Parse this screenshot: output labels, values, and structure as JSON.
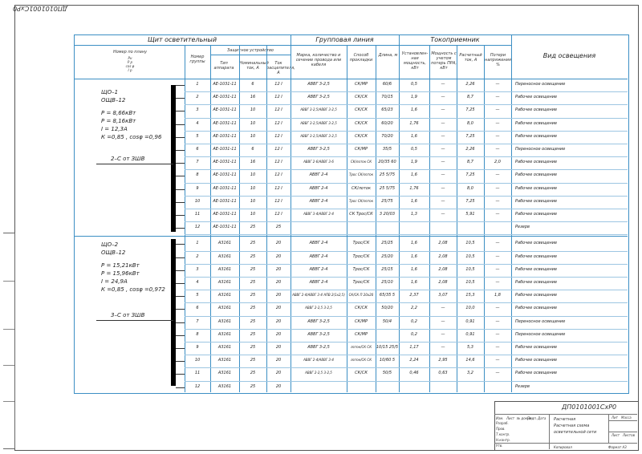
{
  "doc": {
    "stamp_top": "ДП0101001СхР0",
    "code": "ДП0101001СхР0"
  },
  "header": {
    "shield": "Щит осветительный",
    "group_line": "Групповая линия",
    "receiver": "Токоприемник",
    "light_kind": "Вид освещения",
    "plan_no": "Номер по плану",
    "plan_sub": [
      "Рн",
      "Р р",
      "cos φ",
      "I р"
    ],
    "group_no": "Номер группы",
    "protect": "Защитное устройство",
    "device_type": "Тип аппарата",
    "nominal": "Номинальный ток, А",
    "release": "Ток расцепителя, А",
    "cable": "Марка, количество и сечение провода или кабеля",
    "method": "Способ прокладки",
    "length": "Длина, м",
    "installed": "Установлен-ная мощность, кВт",
    "power_corr": "Мощность с учетом потерь ПРА, кВт",
    "calc_current": "Расчетный ток, А",
    "voltage_loss": "Потери напряжения %"
  },
  "panel1": {
    "name1": "ЩО–1",
    "name2": "ОЩВ–12",
    "p_inst": "Р = 8,66кВт",
    "p_calc": "Р = 8,16кВт",
    "i_calc": "I = 12,3А",
    "kc": "К =0,85 , cosφ =0,96",
    "feed": "2–С от ЗШВ"
  },
  "panel2": {
    "name1": "ЩО–2",
    "name2": "ОЩВ–12",
    "p_inst": "Р = 15,21кВт",
    "p_calc": "Р = 15,96кВт",
    "i_calc": "I = 24,9А",
    "kc": "К =0,85 , cosφ =0,972",
    "feed": "3–С от ЗШВ"
  },
  "rows1": [
    {
      "g": "1",
      "type": "АЕ-1031-11",
      "nom": "6",
      "rel": "12 I",
      "cable": "АВВГ 3-2,5",
      "method": "СК/МР",
      "len": "60/6",
      "p": "0,5",
      "pc": "—",
      "i": "2,26",
      "dv": "—",
      "kind": "Переносное освещение"
    },
    {
      "g": "2",
      "type": "АЕ-1031-11",
      "nom": "16",
      "rel": "12 I",
      "cable": "АВВГ 3-2,5",
      "method": "СК/СК",
      "len": "70/15",
      "p": "1,9",
      "pc": "—",
      "i": "8,7",
      "dv": "—",
      "kind": "Рабочее освещение"
    },
    {
      "g": "3",
      "type": "АЕ-1031-11",
      "nom": "10",
      "rel": "12 I",
      "cable": "АВВГ 3-2,5/АВВГ 3-2,5",
      "method": "СК/СК",
      "len": "65/23",
      "p": "1,6",
      "pc": "—",
      "i": "7,25",
      "dv": "—",
      "kind": "Рабочее освещение"
    },
    {
      "g": "4",
      "type": "АЕ-1031-11",
      "nom": "10",
      "rel": "12 I",
      "cable": "АВВГ 3-2,5/АВВГ 3-2,5",
      "method": "СК/СК",
      "len": "60/20",
      "p": "1,76",
      "pc": "—",
      "i": "8,0",
      "dv": "—",
      "kind": "Рабочее освещение"
    },
    {
      "g": "5",
      "type": "АЕ-1031-11",
      "nom": "10",
      "rel": "12 I",
      "cable": "АВВГ 3-2,5/АВВГ 3-2,5",
      "method": "СК/СК",
      "len": "70/20",
      "p": "1,6",
      "pc": "—",
      "i": "7,25",
      "dv": "—",
      "kind": "Рабочее освещение"
    },
    {
      "g": "6",
      "type": "АЕ-1031-11",
      "nom": "6",
      "rel": "12 I",
      "cable": "АВВГ 3-2,5",
      "method": "СК/МР",
      "len": "35/5",
      "p": "0,5",
      "pc": "—",
      "i": "2,26",
      "dv": "—",
      "kind": "Переносное освещение"
    },
    {
      "g": "7",
      "type": "АЕ-1031-11",
      "nom": "16",
      "rel": "12 I",
      "cable": "АВВГ 2-6/АВВГ 3-6",
      "method": "СК/лоток СК",
      "len": "20/35 60",
      "p": "1,9",
      "pc": "—",
      "i": "8,7",
      "dv": "2,0",
      "kind": "Рабочее освещение"
    },
    {
      "g": "8",
      "type": "АЕ-1031-11",
      "nom": "10",
      "rel": "12 I",
      "cable": "АВВГ 2-4",
      "method": "Трос СК/лоток",
      "len": "25 5/75",
      "p": "1,6",
      "pc": "—",
      "i": "7,25",
      "dv": "—",
      "kind": "Рабочее освещение"
    },
    {
      "g": "9",
      "type": "АЕ-1031-11",
      "nom": "10",
      "rel": "12 I",
      "cable": "АВВГ 2-4",
      "method": "СК/лоток",
      "len": "25 5/75",
      "p": "1,76",
      "pc": "—",
      "i": "8,0",
      "dv": "—",
      "kind": "Рабочее освещение"
    },
    {
      "g": "10",
      "type": "АЕ-1031-11",
      "nom": "10",
      "rel": "12 I",
      "cable": "АВВГ 2-4",
      "method": "Трос СК/лоток",
      "len": "25/75",
      "p": "1,6",
      "pc": "—",
      "i": "7,25",
      "dv": "—",
      "kind": "Рабочее освещение"
    },
    {
      "g": "11",
      "type": "АЕ-1031-11",
      "nom": "10",
      "rel": "12 I",
      "cable": "АВВГ 3-4/АВВГ 2-4",
      "method": "СК Трос/СК",
      "len": "3 20/03",
      "p": "1,3",
      "pc": "—",
      "i": "5,91",
      "dv": "—",
      "kind": "Рабочее освещение"
    },
    {
      "g": "12",
      "type": "АЕ-1031-11",
      "nom": "25",
      "rel": "25",
      "cable": "",
      "method": "",
      "len": "",
      "p": "",
      "pc": "",
      "i": "",
      "dv": "",
      "kind": "Резерв"
    }
  ],
  "rows2": [
    {
      "g": "1",
      "type": "А3161",
      "nom": "25",
      "rel": "20",
      "cable": "АВВГ 2-4",
      "method": "Трос/СК",
      "len": "25/25",
      "p": "1,6",
      "pc": "2,08",
      "i": "10,5",
      "dv": "—",
      "kind": "Рабочее освещение"
    },
    {
      "g": "2",
      "type": "А3161",
      "nom": "25",
      "rel": "20",
      "cable": "АВВГ 2-4",
      "method": "Трос/СК",
      "len": "25/20",
      "p": "1,6",
      "pc": "2,08",
      "i": "10,5",
      "dv": "—",
      "kind": "Рабочее освещение"
    },
    {
      "g": "3",
      "type": "А3161",
      "nom": "25",
      "rel": "20",
      "cable": "АВВГ 2-4",
      "method": "Трос/СК",
      "len": "25/15",
      "p": "1,6",
      "pc": "2,08",
      "i": "10,5",
      "dv": "—",
      "kind": "Рабочее освещение"
    },
    {
      "g": "4",
      "type": "А3161",
      "nom": "25",
      "rel": "20",
      "cable": "АВВГ 2-4",
      "method": "Трос/СК",
      "len": "25/10",
      "p": "1,6",
      "pc": "2,08",
      "i": "10,5",
      "dv": "—",
      "kind": "Рабочее освещение"
    },
    {
      "g": "5",
      "type": "А3161",
      "nom": "25",
      "rel": "20",
      "cable": "АВВГ 2-4/АВВГ 3-4 АПВ 2(1х2,5)",
      "method": "СК/СК П 20х20",
      "len": "65/35 5",
      "p": "2,37",
      "pc": "3,07",
      "i": "15,3",
      "dv": "1,8",
      "kind": "Рабочее освещение"
    },
    {
      "g": "6",
      "type": "А3161",
      "nom": "25",
      "rel": "20",
      "cable": "АВВГ 2-2,5 3-2,5",
      "method": "СК/СК",
      "len": "50/20",
      "p": "2,2",
      "pc": "—",
      "i": "10,0",
      "dv": "—",
      "kind": "Рабочее освещение"
    },
    {
      "g": "7",
      "type": "А3161",
      "nom": "25",
      "rel": "20",
      "cable": "АВВГ 3-2,5",
      "method": "СК/МР",
      "len": "50/4",
      "p": "0,2",
      "pc": "—",
      "i": "0,91",
      "dv": "—",
      "kind": "Переносное освещение"
    },
    {
      "g": "8",
      "type": "А3161",
      "nom": "25",
      "rel": "20",
      "cable": "АВВГ 3-2,5",
      "method": "СК/МР",
      "len": "",
      "p": "0,2",
      "pc": "—",
      "i": "0,91",
      "dv": "—",
      "kind": "Переносное освещение"
    },
    {
      "g": "9",
      "type": "А3161",
      "nom": "25",
      "rel": "20",
      "cable": "АВВГ 3-2,5",
      "method": "лоток/СК СК",
      "len": "10/15 25/5",
      "p": "1,17",
      "pc": "—",
      "i": "5,3",
      "dv": "—",
      "kind": "Рабочее освещение"
    },
    {
      "g": "10",
      "type": "А3161",
      "nom": "25",
      "rel": "20",
      "cable": "АВВГ 2-4/АВВГ 3-4",
      "method": "лоток/СК СК",
      "len": "10/60 5",
      "p": "2,24",
      "pc": "2,95",
      "i": "14,6",
      "dv": "—",
      "kind": "Рабочее освещение"
    },
    {
      "g": "11",
      "type": "А3161",
      "nom": "25",
      "rel": "20",
      "cable": "АВВГ 2-2,5 3-2,5",
      "method": "СК/СК",
      "len": "50/5",
      "p": "0,46",
      "pc": "0,63",
      "i": "3,2",
      "dv": "—",
      "kind": "Рабочее освещение"
    },
    {
      "g": "12",
      "type": "А3161",
      "nom": "25",
      "rel": "20",
      "cable": "",
      "method": "",
      "len": "",
      "p": "",
      "pc": "",
      "i": "",
      "dv": "",
      "kind": "Резерв"
    }
  ],
  "titleblock": {
    "code": "ДП0101001СхР0",
    "line1": "Расчетная",
    "line2": "Расчетная схема",
    "line3": "осветительной сети",
    "stage": "Лит",
    "mass": "Масса",
    "scale": "Масштаб",
    "sheet": "Лист",
    "sheets": "Листов",
    "copied": "Копировал",
    "format": "Формат  А3",
    "roles": [
      "Изм.",
      "Лист",
      "№ докум.",
      "Подп.",
      "Дата",
      "Разраб.",
      "Пров.",
      "Т.контр.",
      "Н.контр.",
      "Утв."
    ]
  }
}
